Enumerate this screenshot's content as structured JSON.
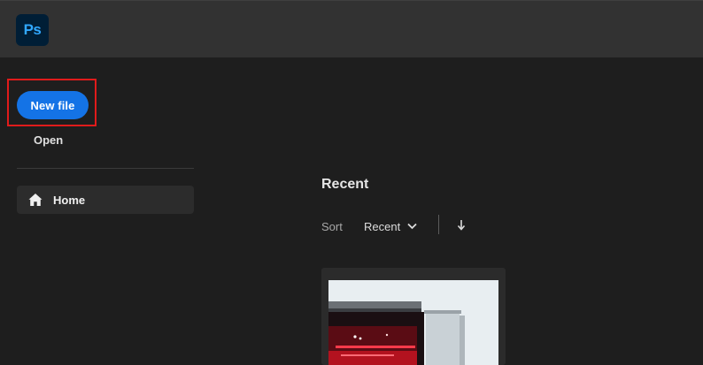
{
  "app": {
    "logo_text": "Ps"
  },
  "sidebar": {
    "new_file_label": "New file",
    "open_label": "Open",
    "nav": [
      {
        "label": "Home",
        "icon": "home-icon"
      }
    ]
  },
  "recent": {
    "title": "Recent",
    "sort_label": "Sort",
    "sort_value": "Recent",
    "sort_direction_icon": "arrow-down-icon"
  },
  "colors": {
    "accent": "#1473e6",
    "highlight": "#e01b1b",
    "logo_bg": "#001e36",
    "logo_fg": "#31a8ff"
  }
}
